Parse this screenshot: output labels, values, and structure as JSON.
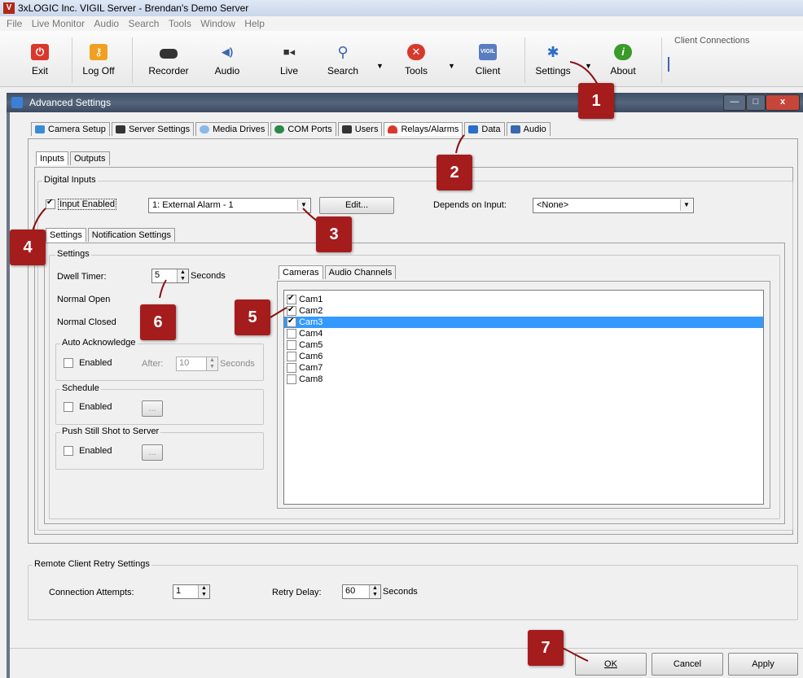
{
  "window": {
    "title": "3xLOGIC Inc. VIGIL Server - Brendan's Demo Server",
    "app_icon_letter": "V"
  },
  "menu": [
    "File",
    "Live Monitor",
    "Audio",
    "Search",
    "Tools",
    "Window",
    "Help"
  ],
  "toolbar": {
    "buttons": [
      {
        "label": "Exit",
        "icon": "power-icon",
        "color": "#d9382c"
      },
      {
        "label": "Log Off",
        "icon": "key-icon",
        "color": "#f0a020"
      },
      {
        "label": "Recorder",
        "icon": "recorder-icon",
        "color": "#333333"
      },
      {
        "label": "Audio",
        "icon": "speaker-icon",
        "color": "#3a66b0"
      },
      {
        "label": "Live",
        "icon": "camera-icon",
        "color": "#333333"
      },
      {
        "label": "Search",
        "icon": "magnifier-icon",
        "color": "#3a66b0"
      },
      {
        "label": "Tools",
        "icon": "tools-icon",
        "color": "#d9382c"
      },
      {
        "label": "Client",
        "icon": "vigil-client-icon",
        "color": "#5a7cc0"
      },
      {
        "label": "Settings",
        "icon": "gear-icon",
        "color": "#2a6ec8"
      },
      {
        "label": "About",
        "icon": "info-icon",
        "color": "#3a9a2a"
      }
    ],
    "client_connections": "Client Connections",
    "vigil_text": "VIGIL",
    "about_glyph": "i"
  },
  "dialog": {
    "title": "Advanced Settings",
    "tabs": [
      "Camera Setup",
      "Server Settings",
      "Media Drives",
      "COM Ports",
      "Users",
      "Relays/Alarms",
      "Data",
      "Audio"
    ],
    "subtabs": [
      "Inputs",
      "Outputs"
    ],
    "digital_inputs": {
      "group_label": "Digital Inputs",
      "input_enabled_label": "Input Enabled",
      "input_enabled": true,
      "input_select": "1: External Alarm - 1",
      "edit_button": "Edit...",
      "depends_label": "Depends on Input:",
      "depends_value": "<None>"
    },
    "inner_tabs": [
      "Settings",
      "Notification Settings"
    ],
    "settings": {
      "group_label": "Settings",
      "dwell_timer_label": "Dwell Timer:",
      "dwell_value": "5",
      "seconds": "Seconds",
      "normal_open": "Normal Open",
      "normal_closed": "Normal Closed",
      "auto_ack_label": "Auto Acknowledge",
      "enabled": "Enabled",
      "after_label": "After:",
      "after_value": "10",
      "schedule_label": "Schedule",
      "push_label": "Push Still Shot to Server",
      "ellipsis": "..."
    },
    "camera_tabs": [
      "Cameras",
      "Audio Channels"
    ],
    "cameras": [
      {
        "name": "Cam1",
        "checked": true,
        "selected": false
      },
      {
        "name": "Cam2",
        "checked": true,
        "selected": false
      },
      {
        "name": "Cam3",
        "checked": true,
        "selected": true
      },
      {
        "name": "Cam4",
        "checked": false,
        "selected": false
      },
      {
        "name": "Cam5",
        "checked": false,
        "selected": false
      },
      {
        "name": "Cam6",
        "checked": false,
        "selected": false
      },
      {
        "name": "Cam7",
        "checked": false,
        "selected": false
      },
      {
        "name": "Cam8",
        "checked": false,
        "selected": false
      }
    ],
    "remote": {
      "group_label": "Remote Client Retry Settings",
      "attempts_label": "Connection Attempts:",
      "attempts_value": "1",
      "retry_label": "Retry Delay:",
      "retry_value": "60",
      "seconds": "Seconds"
    },
    "buttons": {
      "ok": "OK",
      "cancel": "Cancel",
      "apply": "Apply"
    },
    "window_buttons": {
      "minimize": "—",
      "maximize": "□",
      "close": "x"
    }
  },
  "callouts": [
    "1",
    "2",
    "3",
    "4",
    "5",
    "6",
    "7"
  ],
  "colors": {
    "callout": "#a51c1c",
    "selection": "#3399ff",
    "title_bar": "#4a5a70"
  }
}
